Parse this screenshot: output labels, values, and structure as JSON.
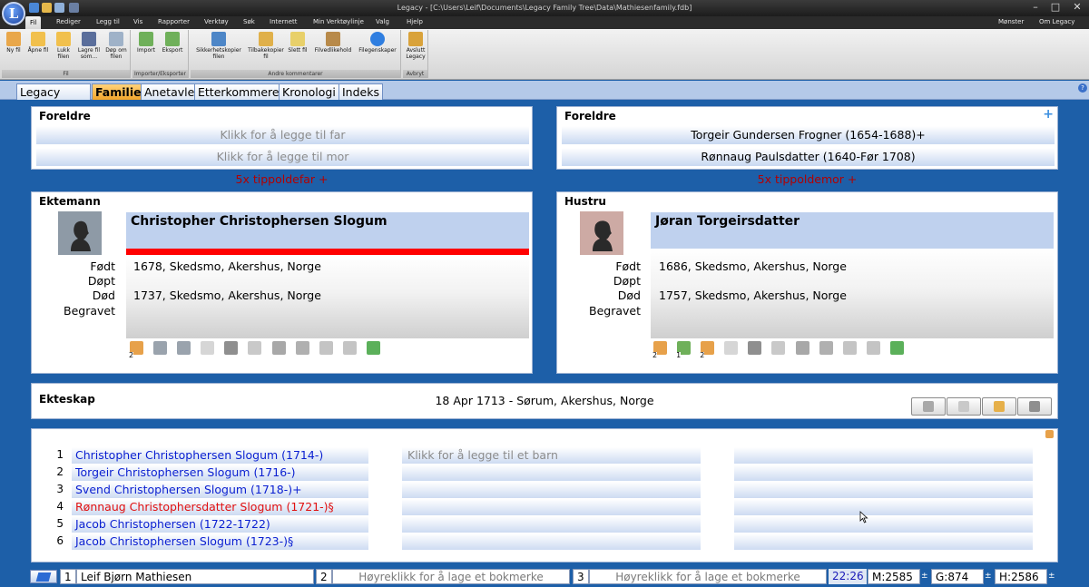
{
  "window": {
    "title": "Legacy - [C:\\Users\\Leif\\Documents\\Legacy Family Tree\\Data\\Mathiesenfamily.fdb]",
    "minimize": "–",
    "maximize": "□",
    "close": "✕"
  },
  "menu": {
    "items": [
      "Fil",
      "Rediger",
      "Legg til",
      "Vis",
      "Rapporter",
      "Verktøy",
      "Søk",
      "Internett",
      "Min Verktøylinje",
      "Valg",
      "Hjelp"
    ],
    "right": [
      "Mønster",
      "Om Legacy"
    ]
  },
  "ribbon": {
    "groups": [
      {
        "label": "Fil",
        "buttons": [
          "Ny fil",
          "Åpne fil",
          "Lukk filen",
          "Lagre fil som...",
          "Døp om filen"
        ]
      },
      {
        "label": "Importer/Eksporter",
        "buttons": [
          "Import",
          "Eksport"
        ]
      },
      {
        "label": "Andre kommentarer",
        "buttons": [
          "Sikkerhetskopier filen",
          "Tilbakekopier fil",
          "Slett fil",
          "Filvedlikehold",
          "Filegenskaper"
        ]
      },
      {
        "label": "Avbryt",
        "buttons": [
          "Avslutt Legacy"
        ]
      }
    ]
  },
  "tabs": [
    "Legacy Start",
    "Familie",
    "Anetavle",
    "Etterkommere",
    "Kronologi",
    "Indeks"
  ],
  "left_parents": {
    "title": "Foreldre",
    "father": "Klikk for å legge til far",
    "mother": "Klikk for å legge til mor",
    "relation": "5x tippoldefar +"
  },
  "right_parents": {
    "title": "Foreldre",
    "father": "Torgeir Gundersen Frogner (1654-1688)+",
    "mother": "Rønnaug Paulsdatter (1640-Før 1708)",
    "relation": "5x tippoldemor +"
  },
  "husband": {
    "title": "Ektemann",
    "name": "Christopher Christophersen Slogum",
    "labels": {
      "born": "Født",
      "baptized": "Døpt",
      "died": "Død",
      "buried": "Begravet"
    },
    "born": "1678, Skedsmo, Akershus, Norge",
    "died": "1737, Skedsmo, Akershus, Norge",
    "icon_badges": [
      "2"
    ]
  },
  "wife": {
    "title": "Hustru",
    "name": "Jøran Torgeirsdatter",
    "labels": {
      "born": "Født",
      "baptized": "Døpt",
      "died": "Død",
      "buried": "Begravet"
    },
    "born": "1686, Skedsmo, Akershus, Norge",
    "died": "1757, Skedsmo, Akershus, Norge",
    "icon_badges": [
      "2",
      "1",
      "2"
    ]
  },
  "marriage": {
    "title": "Ekteskap",
    "event": "18 Apr 1713 - Sørum, Akershus, Norge"
  },
  "children": {
    "numbers": [
      "1",
      "2",
      "3",
      "4",
      "5",
      "6"
    ],
    "list": [
      {
        "name": "Christopher Christophersen Slogum (1714-)",
        "color": "blue"
      },
      {
        "name": "Torgeir Christophersen Slogum (1716-)",
        "color": "blue"
      },
      {
        "name": "Svend Christophersen Slogum (1718-)+",
        "color": "blue"
      },
      {
        "name": "Rønnaug Christophersdatter Slogum (1721-)§",
        "color": "red"
      },
      {
        "name": "Jacob Christophersen (1722-1722)",
        "color": "blue"
      },
      {
        "name": "Jacob Christophersen Slogum (1723-)§",
        "color": "blue"
      }
    ],
    "add_child": "Klikk for å legge til et barn"
  },
  "statusbar": {
    "slot1_num": "1",
    "slot1_name": "Leif Bjørn Mathiesen",
    "slot2_num": "2",
    "slot2_text": "Høyreklikk for å lage et bokmerke",
    "slot3_num": "3",
    "slot3_text": "Høyreklikk for å lage et bokmerke",
    "time": "22:26",
    "m": "M:2585",
    "g": "G:874",
    "h": "H:2586"
  },
  "colors": {
    "background": "#1d5fa8",
    "accent_tab": "#f2a52b",
    "relation_red": "#b30000",
    "link_blue": "#0a1fd1",
    "child_red": "#e01010",
    "name_bg": "#bfd1ee"
  }
}
